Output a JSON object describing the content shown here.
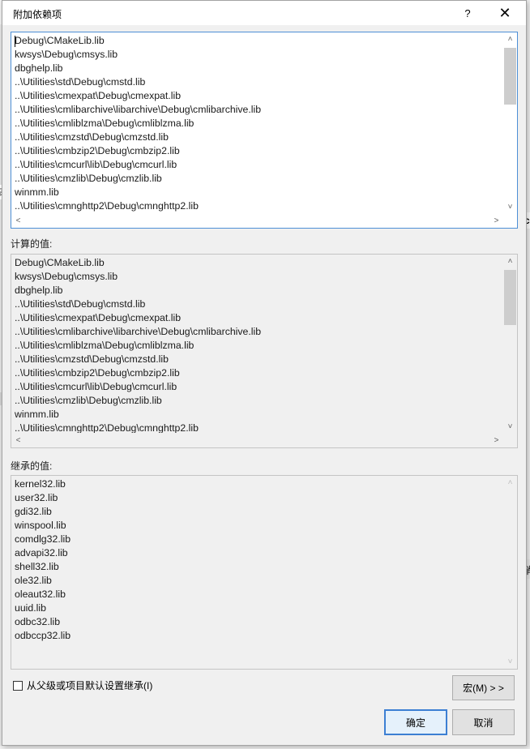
{
  "window": {
    "title": "附加依赖项",
    "help_label": "?",
    "close_label": "✕"
  },
  "editor": {
    "lines": [
      "Debug\\CMakeLib.lib",
      "kwsys\\Debug\\cmsys.lib",
      "dbghelp.lib",
      "..\\Utilities\\std\\Debug\\cmstd.lib",
      "..\\Utilities\\cmexpat\\Debug\\cmexpat.lib",
      "..\\Utilities\\cmlibarchive\\libarchive\\Debug\\cmlibarchive.lib",
      "..\\Utilities\\cmliblzma\\Debug\\cmliblzma.lib",
      "..\\Utilities\\cmzstd\\Debug\\cmzstd.lib",
      "..\\Utilities\\cmbzip2\\Debug\\cmbzip2.lib",
      "..\\Utilities\\cmcurl\\lib\\Debug\\cmcurl.lib",
      "..\\Utilities\\cmzlib\\Debug\\cmzlib.lib",
      "winmm.lib",
      "..\\Utilities\\cmnghttp2\\Debug\\cmnghttp2.lib"
    ]
  },
  "evaluated": {
    "label": "计算的值:",
    "lines": [
      "Debug\\CMakeLib.lib",
      "kwsys\\Debug\\cmsys.lib",
      "dbghelp.lib",
      "..\\Utilities\\std\\Debug\\cmstd.lib",
      "..\\Utilities\\cmexpat\\Debug\\cmexpat.lib",
      "..\\Utilities\\cmlibarchive\\libarchive\\Debug\\cmlibarchive.lib",
      "..\\Utilities\\cmliblzma\\Debug\\cmliblzma.lib",
      "..\\Utilities\\cmzstd\\Debug\\cmzstd.lib",
      "..\\Utilities\\cmbzip2\\Debug\\cmbzip2.lib",
      "..\\Utilities\\cmcurl\\lib\\Debug\\cmcurl.lib",
      "..\\Utilities\\cmzlib\\Debug\\cmzlib.lib",
      "winmm.lib",
      "..\\Utilities\\cmnghttp2\\Debug\\cmnghttp2.lib"
    ]
  },
  "inherited": {
    "label": "继承的值:",
    "lines": [
      "kernel32.lib",
      "user32.lib",
      "gdi32.lib",
      "winspool.lib",
      "comdlg32.lib",
      "advapi32.lib",
      "shell32.lib",
      "ole32.lib",
      "oleaut32.lib",
      "uuid.lib",
      "odbc32.lib",
      "odbccp32.lib"
    ]
  },
  "inherit_checkbox": {
    "label": "从父级或项目默认设置继承(I)",
    "checked": false
  },
  "buttons": {
    "macros": "宏(M) > >",
    "ok": "确定",
    "cancel": "取消"
  },
  "scroll_glyphs": {
    "up": "˄",
    "down": "˅",
    "left": "˂",
    "right": "˃"
  },
  "background_fragments": {
    "a": "码",
    "b": "c",
    "c": "消"
  }
}
